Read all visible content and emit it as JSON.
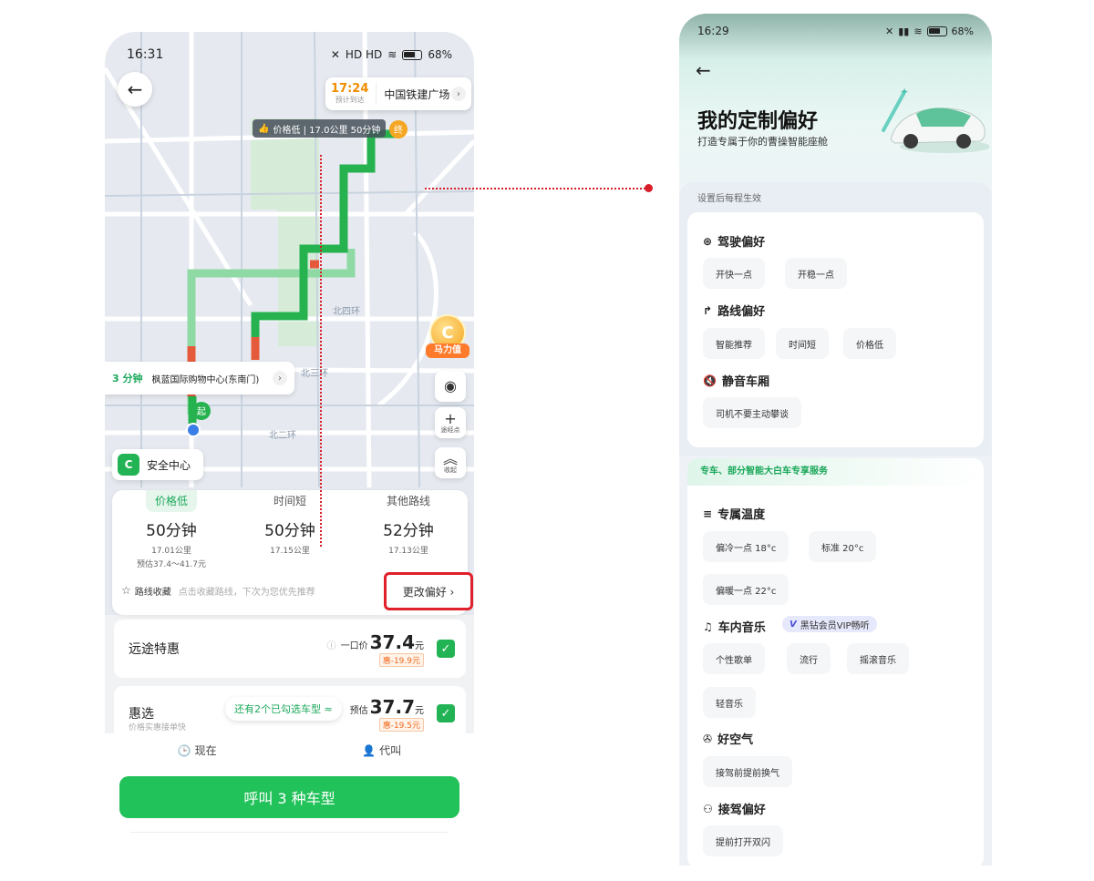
{
  "left": {
    "status": {
      "time": "16:31",
      "battery": "68%",
      "network_icons": "HD HD"
    },
    "eta": {
      "time": "17:24",
      "label": "预计到达",
      "destination": "中国铁建广场"
    },
    "route_label": {
      "text": "价格低 | 17.0公里 50分钟"
    },
    "map_labels": {
      "north_4th_ring": "北四环",
      "north_3rd_ring": "北三环",
      "north_2nd_ring": "北二环",
      "end_marker": "终",
      "start_marker": "起"
    },
    "pickup": {
      "minutes": "3 分钟",
      "place": "枫蓝国际购物中心(东南门)"
    },
    "safety_center": "安全中心",
    "coin_label": "马力值",
    "waypoint_label": "途经点",
    "collapse_label": "收起",
    "route_options": [
      {
        "tab": "价格低",
        "duration": "50分钟",
        "distance": "17.01公里",
        "price": "预估37.4～41.7元",
        "active": true
      },
      {
        "tab": "时间短",
        "duration": "50分钟",
        "distance": "17.15公里",
        "price": "",
        "active": false
      },
      {
        "tab": "其他路线",
        "duration": "52分钟",
        "distance": "17.13公里",
        "price": "",
        "active": false
      }
    ],
    "route_fav": {
      "label": "路线收藏",
      "hint": "点击收藏路线，下次为您优先推荐"
    },
    "change_pref": "更改偏好 ›",
    "cars": [
      {
        "name": "远途特惠",
        "price_label": "一口价",
        "price": "37.4",
        "unit": "元",
        "discount": "惠-19.9元",
        "sub": ""
      },
      {
        "name": "惠选",
        "price_label": "预估",
        "price": "37.7",
        "unit": "元",
        "discount": "惠-19.5元",
        "sub": "价格实惠接单快"
      }
    ],
    "selected_pill": "还有2个已勾选车型 ≈",
    "bottom_options": {
      "now": "现在",
      "proxy": "代叫"
    },
    "call_button": "呼叫 3 种车型"
  },
  "right": {
    "status": {
      "time": "16:29",
      "battery": "68%"
    },
    "title": "我的定制偏好",
    "subtitle": "打造专属于你的曹操智能座舱",
    "note": "设置后每程生效",
    "driving": {
      "title": "驾驶偏好",
      "options": [
        "开快一点",
        "开稳一点"
      ]
    },
    "route": {
      "title": "路线偏好",
      "options": [
        "智能推荐",
        "时间短",
        "价格低"
      ]
    },
    "quiet": {
      "title": "静音车厢",
      "options": [
        "司机不要主动攀谈"
      ]
    },
    "premium_header": "专车、部分智能大白车专享服务",
    "temperature": {
      "title": "专属温度",
      "options": [
        "偏冷一点 18°c",
        "标准 20°c",
        "偏暖一点 22°c"
      ]
    },
    "music": {
      "title": "车内音乐",
      "vip": "黑钻会员VIP畅听",
      "options": [
        "个性歌单",
        "流行",
        "摇滚音乐",
        "轻音乐"
      ]
    },
    "air": {
      "title": "好空气",
      "options": [
        "接驾前提前换气"
      ]
    },
    "pickup_pref": {
      "title": "接驾偏好",
      "options": [
        "提前打开双闪"
      ]
    }
  }
}
